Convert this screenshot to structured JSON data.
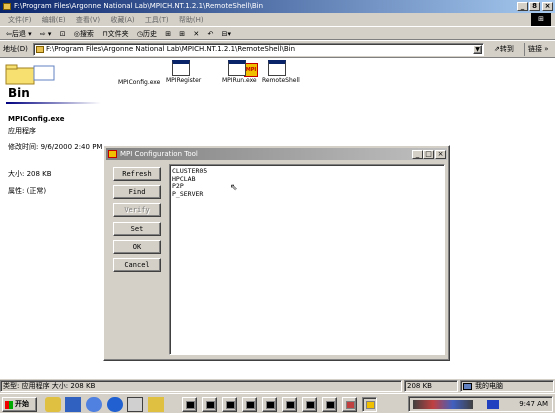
{
  "window": {
    "title": "F:\\Program Files\\Argonne National Lab\\MPICH.NT.1.2.1\\RemoteShell\\Bin",
    "min": "_",
    "max": "8",
    "close": "×"
  },
  "menu": [
    "文件(F)",
    "编辑(E)",
    "查看(V)",
    "收藏(A)",
    "工具(T)",
    "帮助(H)"
  ],
  "toolbar": [
    "⇦后退 ▾",
    "⇨ ▾",
    "⊡",
    "◎搜索",
    "⊓文件夹",
    "◷历史",
    "⊞",
    "⊞",
    "✕",
    "↶",
    "⊟▾"
  ],
  "address": {
    "label": "地址(D)",
    "value": "F:\\Program Files\\Argonne National Lab\\MPICH.NT.1.2.1\\RemoteShell\\Bin",
    "goto": "⇗转到",
    "links": "链接 »"
  },
  "leftpane": {
    "title": "Bin",
    "name": "MPIConfig.exe",
    "type": "应用程序",
    "modified": "修改时间: 9/6/2000 2:40 PM",
    "size": "大小: 208 KB",
    "attr": "属性: (正常)"
  },
  "files": [
    {
      "label": "MPIConfig.exe",
      "icon": "mpi-config-icon"
    },
    {
      "label": "MPIRegister",
      "icon": "exe-icon"
    },
    {
      "label": "MPIRun.exe",
      "icon": "exe-icon"
    },
    {
      "label": "RemoteShell",
      "icon": "exe-icon"
    }
  ],
  "dialog": {
    "title": "MPI Configuration Tool",
    "buttons": [
      {
        "label": "Refresh",
        "disabled": false
      },
      {
        "label": "Find",
        "disabled": false
      },
      {
        "label": "Verify",
        "disabled": true
      },
      {
        "label": "Set",
        "disabled": false
      },
      {
        "label": "OK",
        "disabled": false
      },
      {
        "label": "Cancel",
        "disabled": false
      }
    ],
    "hosts": [
      "CLUSTER05",
      "HPCLAB",
      "P2P",
      "P_SERVER"
    ]
  },
  "status": {
    "left": "类型: 应用程序 大小: 208 KB",
    "size": "208 KB",
    "zone": "我的电脑"
  },
  "taskbar": {
    "start": "开始",
    "clock": "9:47 AM"
  }
}
